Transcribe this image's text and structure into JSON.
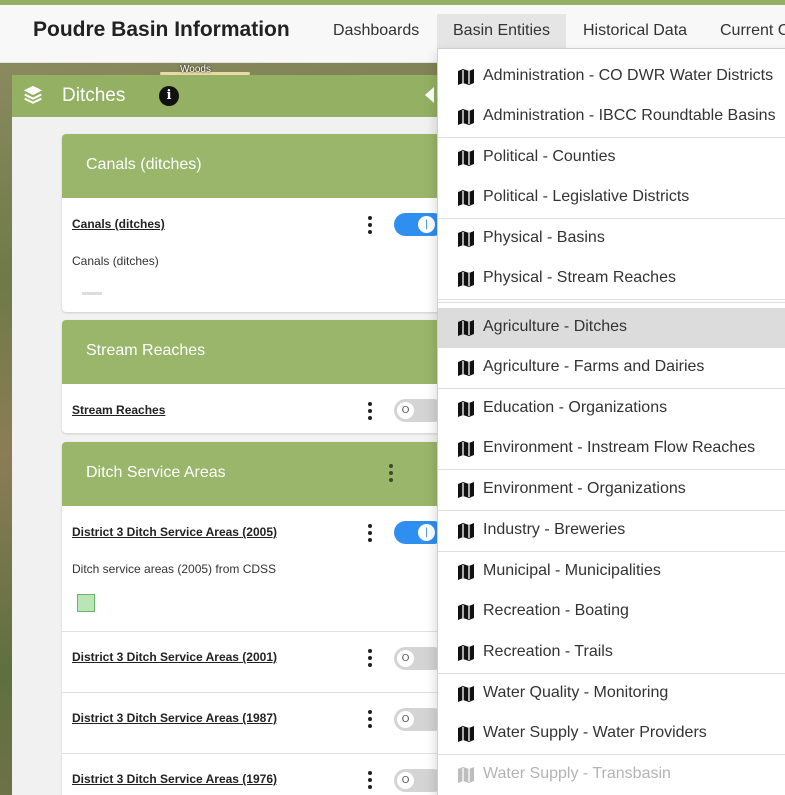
{
  "navbar": {
    "brand": "Poudre Basin Information",
    "items": [
      {
        "label": "Dashboards"
      },
      {
        "label": "Basin Entities"
      },
      {
        "label": "Historical Data"
      },
      {
        "label": "Current C"
      }
    ],
    "active_item": "Basin Entities"
  },
  "map": {
    "place_label": "Woods"
  },
  "layer_panel": {
    "title": "Ditches",
    "header_color": "#93b063",
    "groups": [
      {
        "title": "Canals (ditches)",
        "layers": [
          {
            "name": "Canals (ditches)",
            "enabled": true,
            "description": "Canals (ditches)",
            "legend": "line"
          }
        ]
      },
      {
        "title": "Stream Reaches",
        "layers": [
          {
            "name": "Stream Reaches",
            "enabled": false
          }
        ]
      },
      {
        "title": "Ditch Service Areas",
        "layers": [
          {
            "name": "District 3 Ditch Service Areas (2005)",
            "enabled": true,
            "description": "Ditch service areas (2005) from CDSS",
            "legend": "polygon"
          },
          {
            "name": "District 3 Ditch Service Areas (2001)",
            "enabled": false
          },
          {
            "name": "District 3 Ditch Service Areas (1987)",
            "enabled": false
          },
          {
            "name": "District 3 Ditch Service Areas (1976)",
            "enabled": false
          }
        ]
      }
    ],
    "toggle_on_color": "#2f8ff0",
    "toggle_on_symbol": "|",
    "toggle_off_symbol": "O"
  },
  "dropdown": {
    "items": [
      {
        "label": "Administration - CO DWR Water Districts",
        "icon": "map-icon"
      },
      {
        "label": "Administration - IBCC Roundtable Basins",
        "icon": "map-icon"
      },
      {
        "label": "Political - Counties",
        "icon": "map-icon"
      },
      {
        "label": "Political - Legislative Districts",
        "icon": "map-icon"
      },
      {
        "label": "Physical - Basins",
        "icon": "map-icon"
      },
      {
        "label": "Physical - Stream Reaches",
        "icon": "map-icon"
      },
      {
        "label": "Agriculture - Ditches",
        "icon": "map-icon",
        "active": true
      },
      {
        "label": "Agriculture - Farms and Dairies",
        "icon": "map-icon"
      },
      {
        "label": "Education - Organizations",
        "icon": "map-icon"
      },
      {
        "label": "Environment - Instream Flow Reaches",
        "icon": "map-icon"
      },
      {
        "label": "Environment - Organizations",
        "icon": "map-icon"
      },
      {
        "label": "Industry - Breweries",
        "icon": "map-icon"
      },
      {
        "label": "Municipal - Municipalities",
        "icon": "map-icon"
      },
      {
        "label": "Recreation - Boating",
        "icon": "map-icon"
      },
      {
        "label": "Recreation - Trails",
        "icon": "map-icon"
      },
      {
        "label": "Water Quality - Monitoring",
        "icon": "map-icon"
      },
      {
        "label": "Water Supply - Water Providers",
        "icon": "map-icon"
      },
      {
        "label": "Water Supply - Transbasin",
        "icon": "map-icon",
        "disabled": true
      }
    ]
  }
}
